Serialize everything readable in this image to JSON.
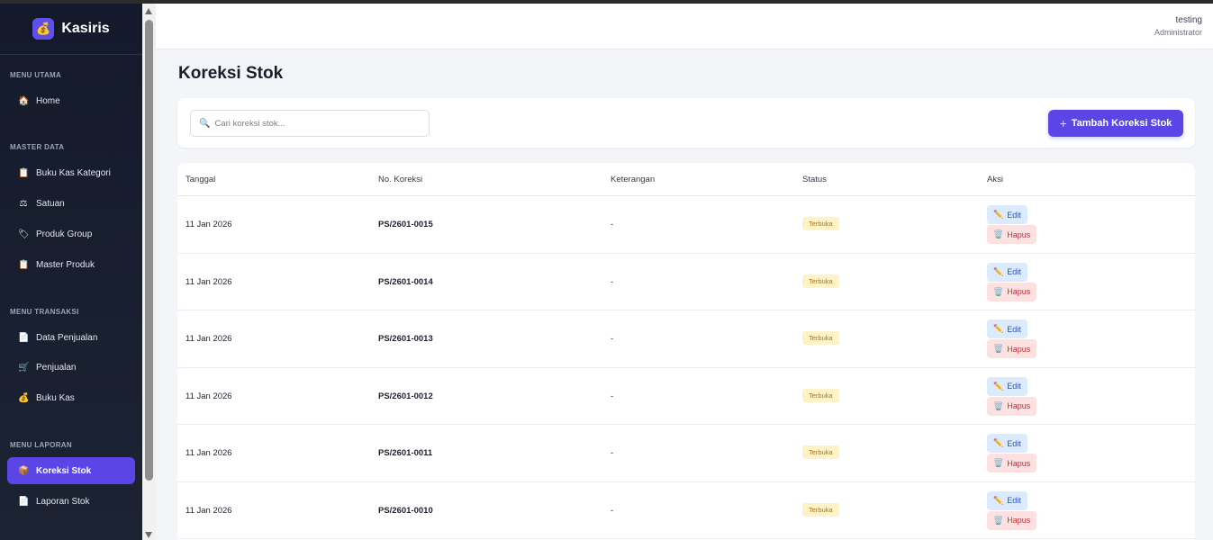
{
  "app": {
    "name": "Kasiris",
    "logo_icon": "money-bag-icon",
    "accent": "#5b45e6"
  },
  "user": {
    "name": "testing",
    "role": "Administrator"
  },
  "sidebar": {
    "sections": [
      {
        "title": "MENU UTAMA"
      },
      {
        "title": "MASTER DATA"
      },
      {
        "title": "MENU TRANSAKSI"
      },
      {
        "title": "MENU LAPORAN"
      }
    ],
    "items": [
      {
        "label": "Home",
        "icon": "🏠"
      },
      {
        "label": "Buku Kas Kategori",
        "icon": "📋"
      },
      {
        "label": "Satuan",
        "icon": "⚖"
      },
      {
        "label": "Produk Group",
        "icon": "🏷"
      },
      {
        "label": "Master Produk",
        "icon": "📋"
      },
      {
        "label": "Data Penjualan",
        "icon": "📄"
      },
      {
        "label": "Penjualan",
        "icon": "🛒"
      },
      {
        "label": "Buku Kas",
        "icon": "💰"
      },
      {
        "label": "Koreksi Stok",
        "icon": "📦",
        "active": true
      },
      {
        "label": "Laporan Stok",
        "icon": "📄"
      }
    ]
  },
  "page": {
    "title": "Koreksi Stok",
    "search_placeholder": "Cari koreksi stok...",
    "add_button": "Tambah Koreksi Stok"
  },
  "table": {
    "columns": [
      "Tanggal",
      "No. Koreksi",
      "Keterangan",
      "Status",
      "Aksi"
    ],
    "edit_label": "Edit",
    "delete_label": "Hapus",
    "rows": [
      {
        "date": "11 Jan 2026",
        "number": "PS/2601-0015",
        "note": "-",
        "status": "Terbuka"
      },
      {
        "date": "11 Jan 2026",
        "number": "PS/2601-0014",
        "note": "-",
        "status": "Terbuka"
      },
      {
        "date": "11 Jan 2026",
        "number": "PS/2601-0013",
        "note": "-",
        "status": "Terbuka"
      },
      {
        "date": "11 Jan 2026",
        "number": "PS/2601-0012",
        "note": "-",
        "status": "Terbuka"
      },
      {
        "date": "11 Jan 2026",
        "number": "PS/2601-0011",
        "note": "-",
        "status": "Terbuka"
      },
      {
        "date": "11 Jan 2026",
        "number": "PS/2601-0010",
        "note": "-",
        "status": "Terbuka"
      }
    ]
  }
}
